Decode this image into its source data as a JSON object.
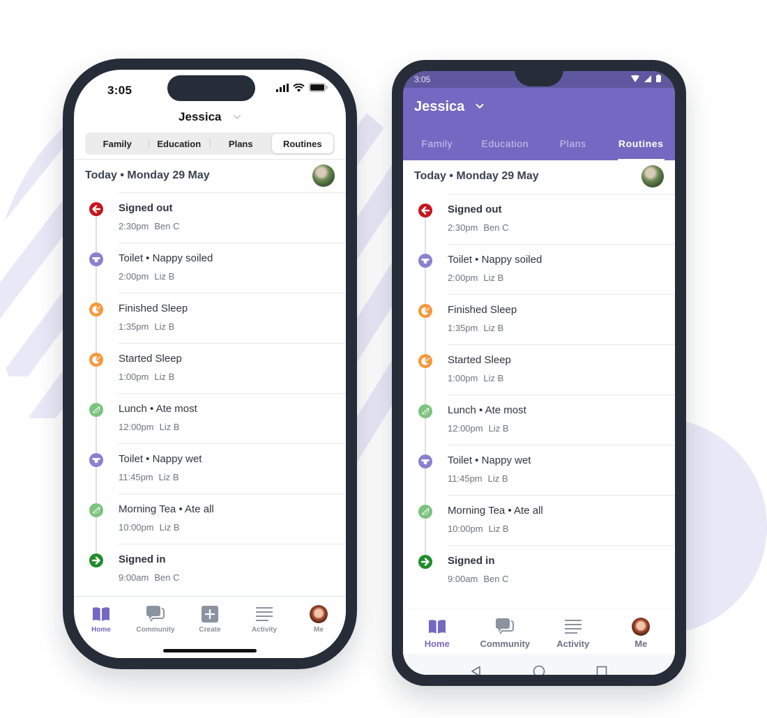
{
  "colors": {
    "brand": "#7468c2",
    "signed_out": "#c8141c",
    "toilet": "#8a80d0",
    "sleep": "#f7973a",
    "meal": "#7cc37f",
    "signed_in": "#1f8c2a"
  },
  "child": {
    "name": "Jessica"
  },
  "date_label": "Today • Monday 29 May",
  "tabs": [
    {
      "label": "Family",
      "active": false
    },
    {
      "label": "Education",
      "active": false
    },
    {
      "label": "Plans",
      "active": false
    },
    {
      "label": "Routines",
      "active": true
    }
  ],
  "events": [
    {
      "title": "Signed out",
      "bold": true,
      "time": "2:30pm",
      "by": "Ben C",
      "icon": "signed-out-icon",
      "kind": "signed_out"
    },
    {
      "title": "Toilet • Nappy soiled",
      "bold": false,
      "time": "2:00pm",
      "by": "Liz B",
      "icon": "nappy-icon",
      "kind": "toilet"
    },
    {
      "title": "Finished Sleep",
      "bold": false,
      "time": "1:35pm",
      "by": "Liz B",
      "icon": "sleep-icon",
      "kind": "sleep"
    },
    {
      "title": "Started Sleep",
      "bold": false,
      "time": "1:00pm",
      "by": "Liz B",
      "icon": "sleep-icon",
      "kind": "sleep"
    },
    {
      "title": "Lunch • Ate most",
      "bold": false,
      "time": "12:00pm",
      "by": "Liz B",
      "icon": "meal-icon",
      "kind": "meal"
    },
    {
      "title": "Toilet • Nappy wet",
      "bold": false,
      "time": "11:45pm",
      "by": "Liz B",
      "icon": "nappy-icon",
      "kind": "toilet"
    },
    {
      "title": "Morning Tea • Ate all",
      "bold": false,
      "time": "10:00pm",
      "by": "Liz B",
      "icon": "meal-icon",
      "kind": "meal"
    },
    {
      "title": "Signed in",
      "bold": true,
      "time": "9:00am",
      "by": "Ben C",
      "icon": "signed-in-icon",
      "kind": "signed_in"
    }
  ],
  "ios": {
    "status_time": "3:05",
    "tabbar": [
      {
        "label": "Home",
        "icon": "book-icon",
        "active": true
      },
      {
        "label": "Community",
        "icon": "chat-icon",
        "active": false
      },
      {
        "label": "Create",
        "icon": "plus-icon",
        "active": false
      },
      {
        "label": "Activity",
        "icon": "list-icon",
        "active": false
      },
      {
        "label": "Me",
        "icon": "avatar",
        "active": false
      }
    ]
  },
  "android": {
    "status_time": "3:05",
    "bottomnav": [
      {
        "label": "Home",
        "icon": "book-icon",
        "active": true
      },
      {
        "label": "Community",
        "icon": "chat-icon",
        "active": false
      },
      {
        "label": "Activity",
        "icon": "list-icon",
        "active": false
      },
      {
        "label": "Me",
        "icon": "avatar",
        "active": false
      }
    ]
  }
}
